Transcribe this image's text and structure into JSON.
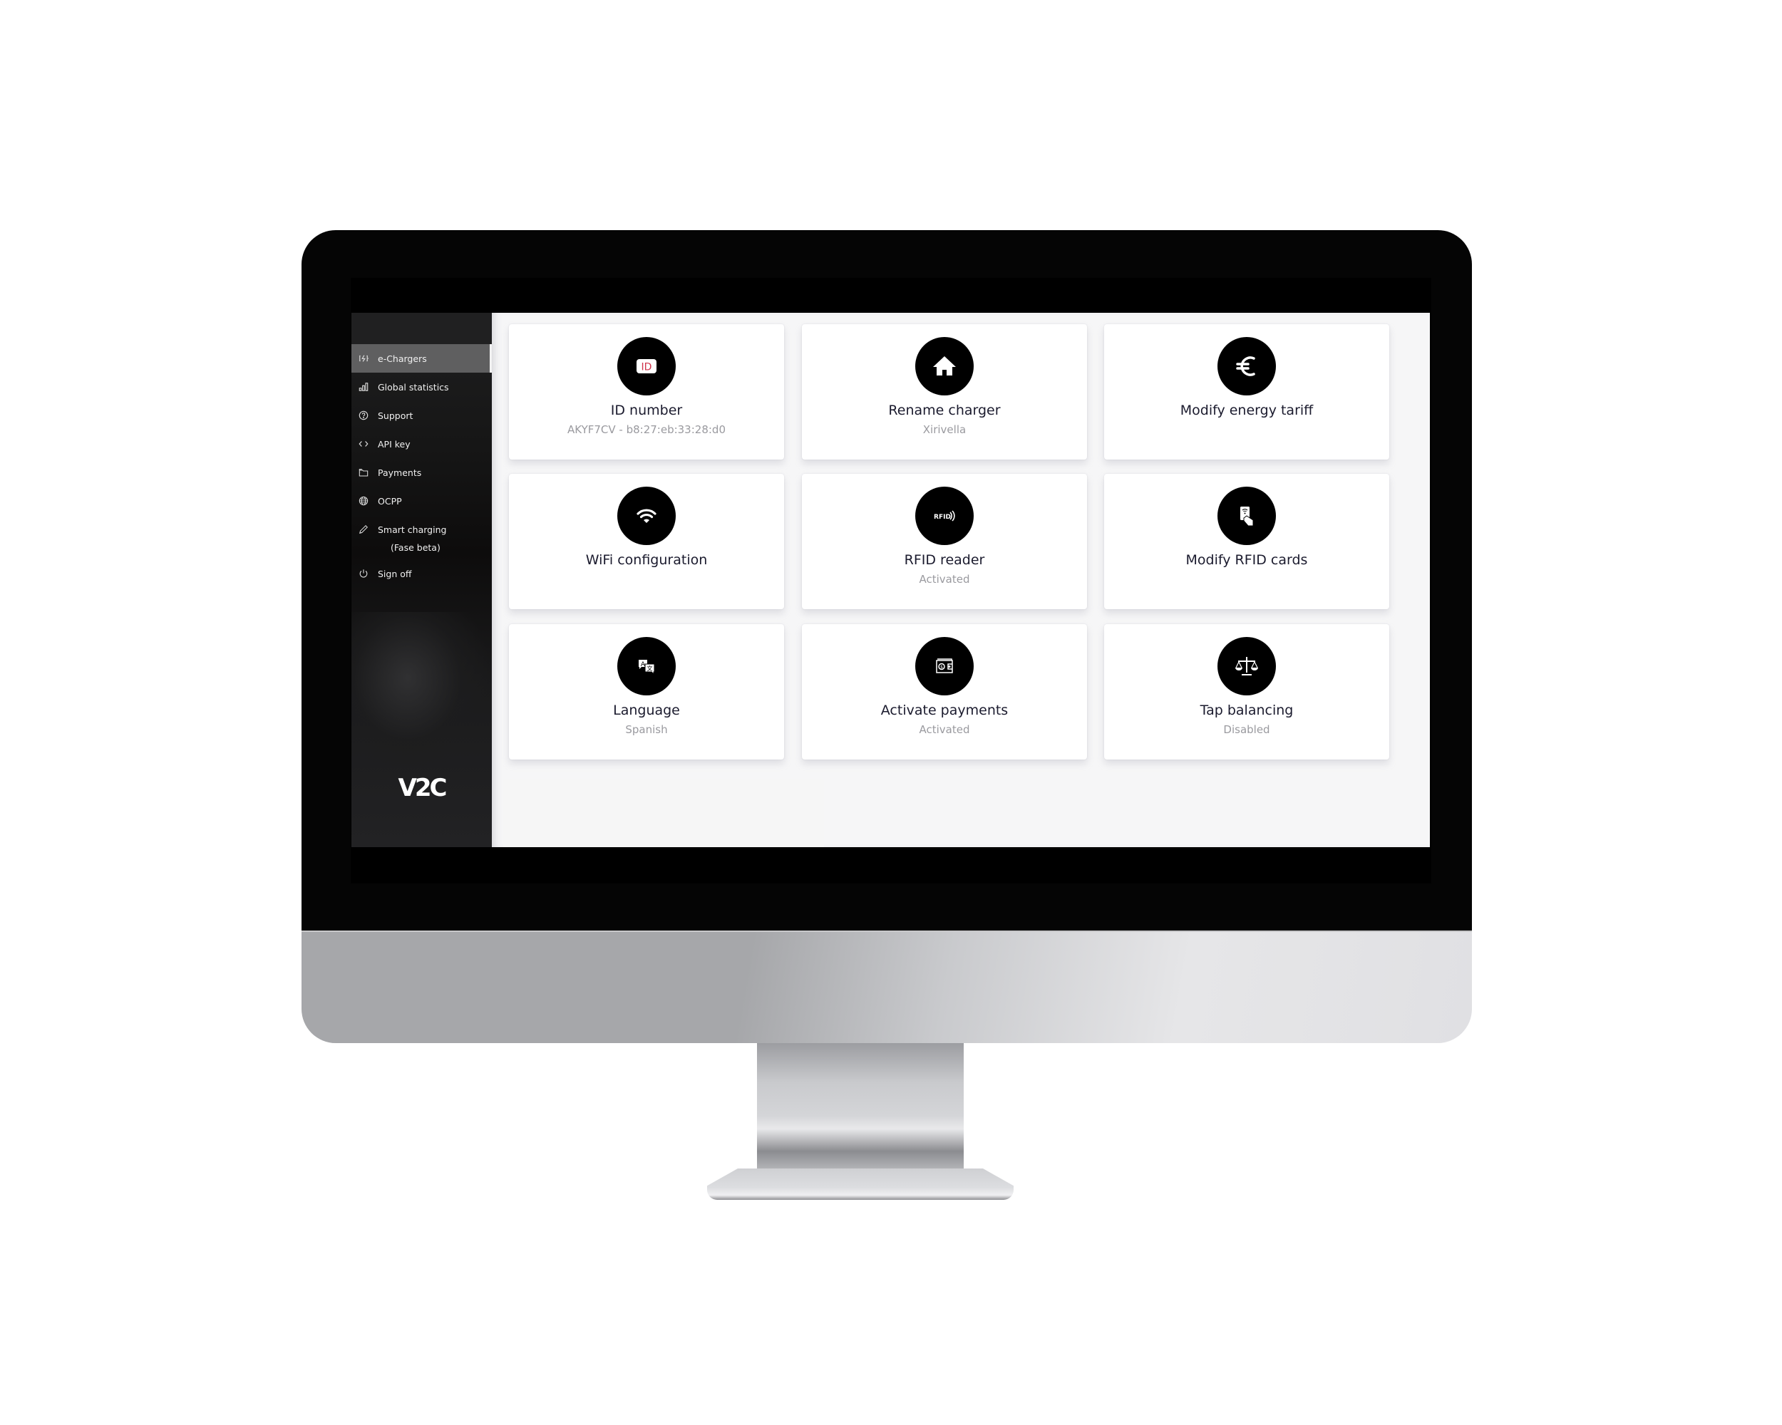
{
  "sidebar": {
    "items": [
      {
        "label": "e-Chargers",
        "icon": "charger-icon",
        "active": true
      },
      {
        "label": "Global statistics",
        "icon": "bar-chart-icon"
      },
      {
        "label": "Support",
        "icon": "help-circle-icon"
      },
      {
        "label": "API key",
        "icon": "code-icon"
      },
      {
        "label": "Payments",
        "icon": "wallet-icon"
      },
      {
        "label": "OCPP",
        "icon": "globe-icon"
      },
      {
        "label": "Smart charging",
        "sublabel": "(Fase beta)",
        "icon": "pencil-icon"
      },
      {
        "label": "Sign off",
        "icon": "power-icon"
      }
    ],
    "logo": "V2C"
  },
  "cards": [
    {
      "title": "ID number",
      "value": "AKYF7CV - b8:27:eb:33:28:d0",
      "icon": "id-badge-icon",
      "accent": "#d0334b"
    },
    {
      "title": "Rename charger",
      "value": "Xirivella",
      "icon": "home-icon"
    },
    {
      "title": "Modify energy tariff",
      "value": "",
      "icon": "euro-icon"
    },
    {
      "title": "WiFi configuration",
      "value": "",
      "icon": "wifi-icon"
    },
    {
      "title": "RFID reader",
      "value": "Activated",
      "icon": "rfid-icon",
      "icon_text": "RFID"
    },
    {
      "title": "Modify RFID cards",
      "value": "",
      "icon": "rfid-card-hand-icon"
    },
    {
      "title": "Language",
      "value": "Spanish",
      "icon": "translate-icon",
      "icon_text": "A",
      "icon_text2": "文"
    },
    {
      "title": "Activate payments",
      "value": "Activated",
      "icon": "wallet-dollar-icon",
      "icon_text": "$"
    },
    {
      "title": "Tap balancing",
      "value": "Disabled",
      "icon": "scale-icon"
    }
  ]
}
